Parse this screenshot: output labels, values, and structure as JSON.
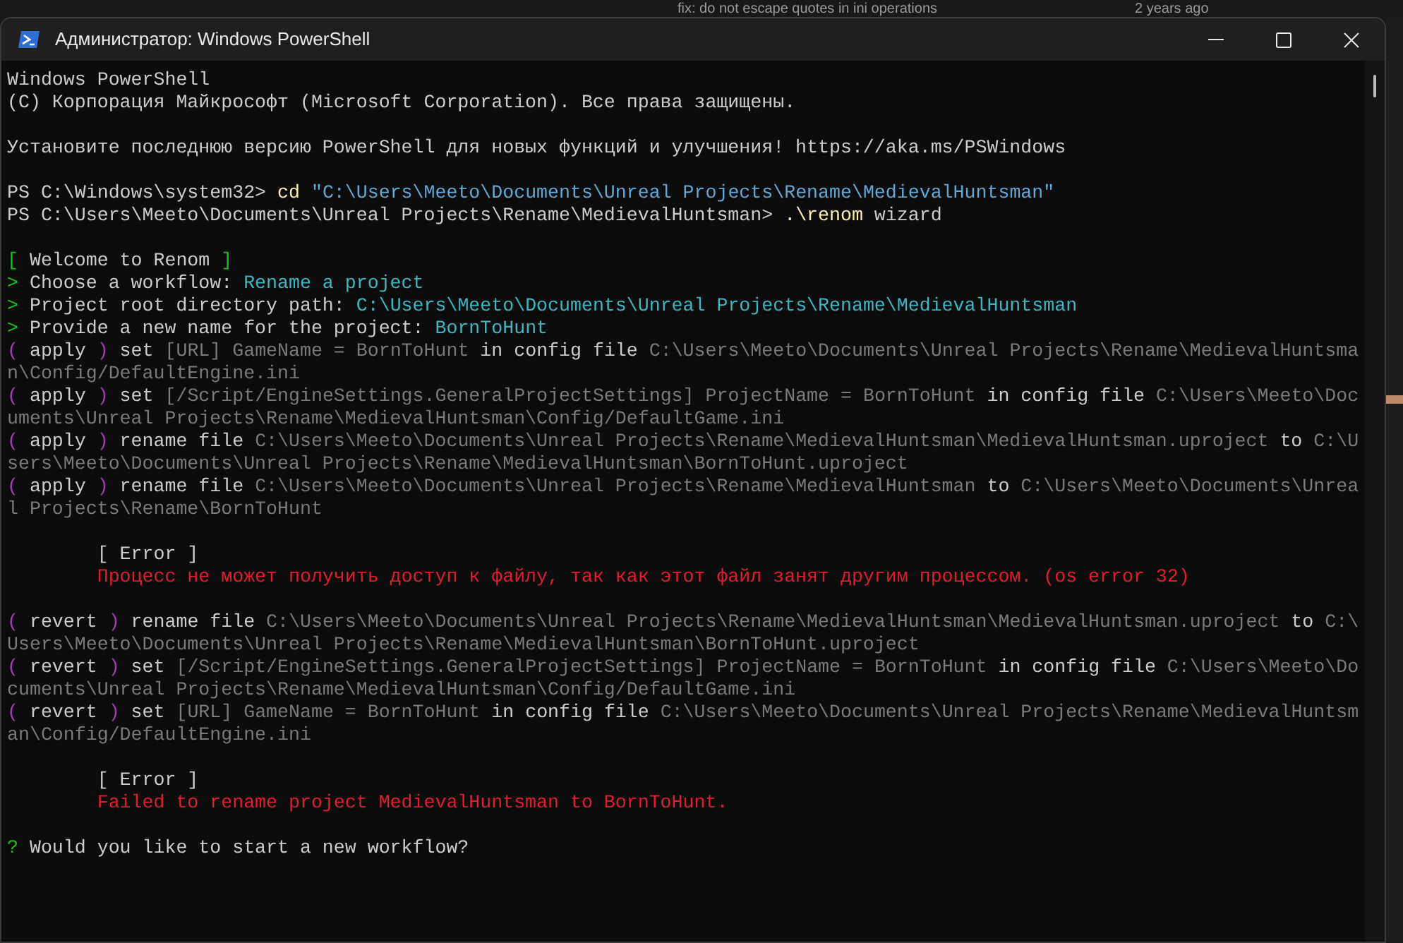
{
  "background": {
    "commit_message": "fix: do not escape quotes in ini operations",
    "commit_age": "2 years ago"
  },
  "window": {
    "title": "Администратор: Windows PowerShell"
  },
  "terminal": {
    "lines": [
      {
        "kind": "text",
        "segments": [
          {
            "kind": "plain",
            "text": "Windows PowerShell"
          }
        ]
      },
      {
        "kind": "text",
        "segments": [
          {
            "kind": "plain",
            "text": "(C) Корпорация Майкрософт (Microsoft Corporation). Все права защищены."
          }
        ]
      },
      {
        "kind": "blank"
      },
      {
        "kind": "text",
        "segments": [
          {
            "kind": "plain",
            "text": "Установите последнюю версию PowerShell для новых функций и улучшения! https://aka.ms/PSWindows"
          }
        ]
      },
      {
        "kind": "blank"
      },
      {
        "kind": "text",
        "segments": [
          {
            "kind": "plain",
            "text": "PS C:\\Windows\\system32> "
          },
          {
            "kind": "command",
            "text": "cd"
          },
          {
            "kind": "string",
            "text": " \"C:\\Users\\Meeto\\Documents\\Unreal Projects\\Rename\\MedievalHuntsman\""
          }
        ]
      },
      {
        "kind": "text",
        "segments": [
          {
            "kind": "plain",
            "text": "PS C:\\Users\\Meeto\\Documents\\Unreal Projects\\Rename\\MedievalHuntsman> "
          },
          {
            "kind": "command",
            "text": ".\\renom"
          },
          {
            "kind": "plain",
            "text": " wizard"
          }
        ]
      },
      {
        "kind": "blank"
      },
      {
        "kind": "text",
        "segments": [
          {
            "kind": "green",
            "text": "["
          },
          {
            "kind": "plain",
            "text": " Welcome to Renom "
          },
          {
            "kind": "green",
            "text": "]"
          }
        ]
      },
      {
        "kind": "text",
        "segments": [
          {
            "kind": "green",
            "text": ">"
          },
          {
            "kind": "plain",
            "text": " Choose a workflow: "
          },
          {
            "kind": "cyan",
            "text": "Rename a project"
          }
        ]
      },
      {
        "kind": "text",
        "segments": [
          {
            "kind": "green",
            "text": ">"
          },
          {
            "kind": "plain",
            "text": " Project root directory path: "
          },
          {
            "kind": "cyan",
            "text": "C:\\Users\\Meeto\\Documents\\Unreal Projects\\Rename\\MedievalHuntsman"
          }
        ]
      },
      {
        "kind": "text",
        "segments": [
          {
            "kind": "green",
            "text": ">"
          },
          {
            "kind": "plain",
            "text": " Provide a new name for the project: "
          },
          {
            "kind": "cyan",
            "text": "BornToHunt"
          }
        ]
      },
      {
        "kind": "text",
        "segments": [
          {
            "kind": "bracket",
            "text": "("
          },
          {
            "kind": "plain",
            "text": " apply "
          },
          {
            "kind": "bracket",
            "text": ")"
          },
          {
            "kind": "plain",
            "text": " set "
          },
          {
            "kind": "dim",
            "text": "[URL] GameName = BornToHunt"
          },
          {
            "kind": "plain",
            "text": " in config file "
          },
          {
            "kind": "dim",
            "text": "C:\\Users\\Meeto\\Documents\\Unreal Projects\\Rename\\MedievalHuntsma"
          }
        ]
      },
      {
        "kind": "text",
        "segments": [
          {
            "kind": "dim",
            "text": "n\\Config/DefaultEngine.ini"
          }
        ]
      },
      {
        "kind": "text",
        "segments": [
          {
            "kind": "bracket",
            "text": "("
          },
          {
            "kind": "plain",
            "text": " apply "
          },
          {
            "kind": "bracket",
            "text": ")"
          },
          {
            "kind": "plain",
            "text": " set "
          },
          {
            "kind": "dim",
            "text": "[/Script/EngineSettings.GeneralProjectSettings] ProjectName = BornToHunt"
          },
          {
            "kind": "plain",
            "text": " in config file "
          },
          {
            "kind": "dim",
            "text": "C:\\Users\\Meeto\\Doc"
          }
        ]
      },
      {
        "kind": "text",
        "segments": [
          {
            "kind": "dim",
            "text": "uments\\Unreal Projects\\Rename\\MedievalHuntsman\\Config/DefaultGame.ini"
          }
        ]
      },
      {
        "kind": "text",
        "segments": [
          {
            "kind": "bracket",
            "text": "("
          },
          {
            "kind": "plain",
            "text": " apply "
          },
          {
            "kind": "bracket",
            "text": ")"
          },
          {
            "kind": "plain",
            "text": " rename file "
          },
          {
            "kind": "dim",
            "text": "C:\\Users\\Meeto\\Documents\\Unreal Projects\\Rename\\MedievalHuntsman\\MedievalHuntsman.uproject"
          },
          {
            "kind": "plain",
            "text": " to "
          },
          {
            "kind": "dim",
            "text": "C:\\U"
          }
        ]
      },
      {
        "kind": "text",
        "segments": [
          {
            "kind": "dim",
            "text": "sers\\Meeto\\Documents\\Unreal Projects\\Rename\\MedievalHuntsman\\BornToHunt.uproject"
          }
        ]
      },
      {
        "kind": "text",
        "segments": [
          {
            "kind": "bracket",
            "text": "("
          },
          {
            "kind": "plain",
            "text": " apply "
          },
          {
            "kind": "bracket",
            "text": ")"
          },
          {
            "kind": "plain",
            "text": " rename file "
          },
          {
            "kind": "dim",
            "text": "C:\\Users\\Meeto\\Documents\\Unreal Projects\\Rename\\MedievalHuntsman"
          },
          {
            "kind": "plain",
            "text": " to "
          },
          {
            "kind": "dim",
            "text": "C:\\Users\\Meeto\\Documents\\Unrea"
          }
        ]
      },
      {
        "kind": "text",
        "segments": [
          {
            "kind": "dim",
            "text": "l Projects\\Rename\\BornToHunt"
          }
        ]
      },
      {
        "kind": "blank"
      },
      {
        "kind": "text",
        "segments": [
          {
            "kind": "plain",
            "text": "        [ Error ]"
          }
        ]
      },
      {
        "kind": "text",
        "segments": [
          {
            "kind": "red",
            "text": "        Процесс не может получить доступ к файлу, так как этот файл занят другим процессом. (os error 32)"
          }
        ]
      },
      {
        "kind": "blank"
      },
      {
        "kind": "text",
        "segments": [
          {
            "kind": "bracket",
            "text": "("
          },
          {
            "kind": "plain",
            "text": " revert "
          },
          {
            "kind": "bracket",
            "text": ")"
          },
          {
            "kind": "plain",
            "text": " rename file "
          },
          {
            "kind": "dim",
            "text": "C:\\Users\\Meeto\\Documents\\Unreal Projects\\Rename\\MedievalHuntsman\\MedievalHuntsman.uproject"
          },
          {
            "kind": "plain",
            "text": " to "
          },
          {
            "kind": "dim",
            "text": "C:\\"
          }
        ]
      },
      {
        "kind": "text",
        "segments": [
          {
            "kind": "dim",
            "text": "Users\\Meeto\\Documents\\Unreal Projects\\Rename\\MedievalHuntsman\\BornToHunt.uproject"
          }
        ]
      },
      {
        "kind": "text",
        "segments": [
          {
            "kind": "bracket",
            "text": "("
          },
          {
            "kind": "plain",
            "text": " revert "
          },
          {
            "kind": "bracket",
            "text": ")"
          },
          {
            "kind": "plain",
            "text": " set "
          },
          {
            "kind": "dim",
            "text": "[/Script/EngineSettings.GeneralProjectSettings] ProjectName = BornToHunt"
          },
          {
            "kind": "plain",
            "text": " in config file "
          },
          {
            "kind": "dim",
            "text": "C:\\Users\\Meeto\\Do"
          }
        ]
      },
      {
        "kind": "text",
        "segments": [
          {
            "kind": "dim",
            "text": "cuments\\Unreal Projects\\Rename\\MedievalHuntsman\\Config/DefaultGame.ini"
          }
        ]
      },
      {
        "kind": "text",
        "segments": [
          {
            "kind": "bracket",
            "text": "("
          },
          {
            "kind": "plain",
            "text": " revert "
          },
          {
            "kind": "bracket",
            "text": ")"
          },
          {
            "kind": "plain",
            "text": " set "
          },
          {
            "kind": "dim",
            "text": "[URL] GameName = BornToHunt"
          },
          {
            "kind": "plain",
            "text": " in config file "
          },
          {
            "kind": "dim",
            "text": "C:\\Users\\Meeto\\Documents\\Unreal Projects\\Rename\\MedievalHuntsm"
          }
        ]
      },
      {
        "kind": "text",
        "segments": [
          {
            "kind": "dim",
            "text": "an\\Config/DefaultEngine.ini"
          }
        ]
      },
      {
        "kind": "blank"
      },
      {
        "kind": "text",
        "segments": [
          {
            "kind": "plain",
            "text": "        [ Error ]"
          }
        ]
      },
      {
        "kind": "text",
        "segments": [
          {
            "kind": "red",
            "text": "        Failed to rename project MedievalHuntsman to BornToHunt."
          }
        ]
      },
      {
        "kind": "blank"
      },
      {
        "kind": "text",
        "segments": [
          {
            "kind": "green",
            "text": "?"
          },
          {
            "kind": "plain",
            "text": " Would you like to start a new workflow?"
          }
        ]
      }
    ]
  }
}
